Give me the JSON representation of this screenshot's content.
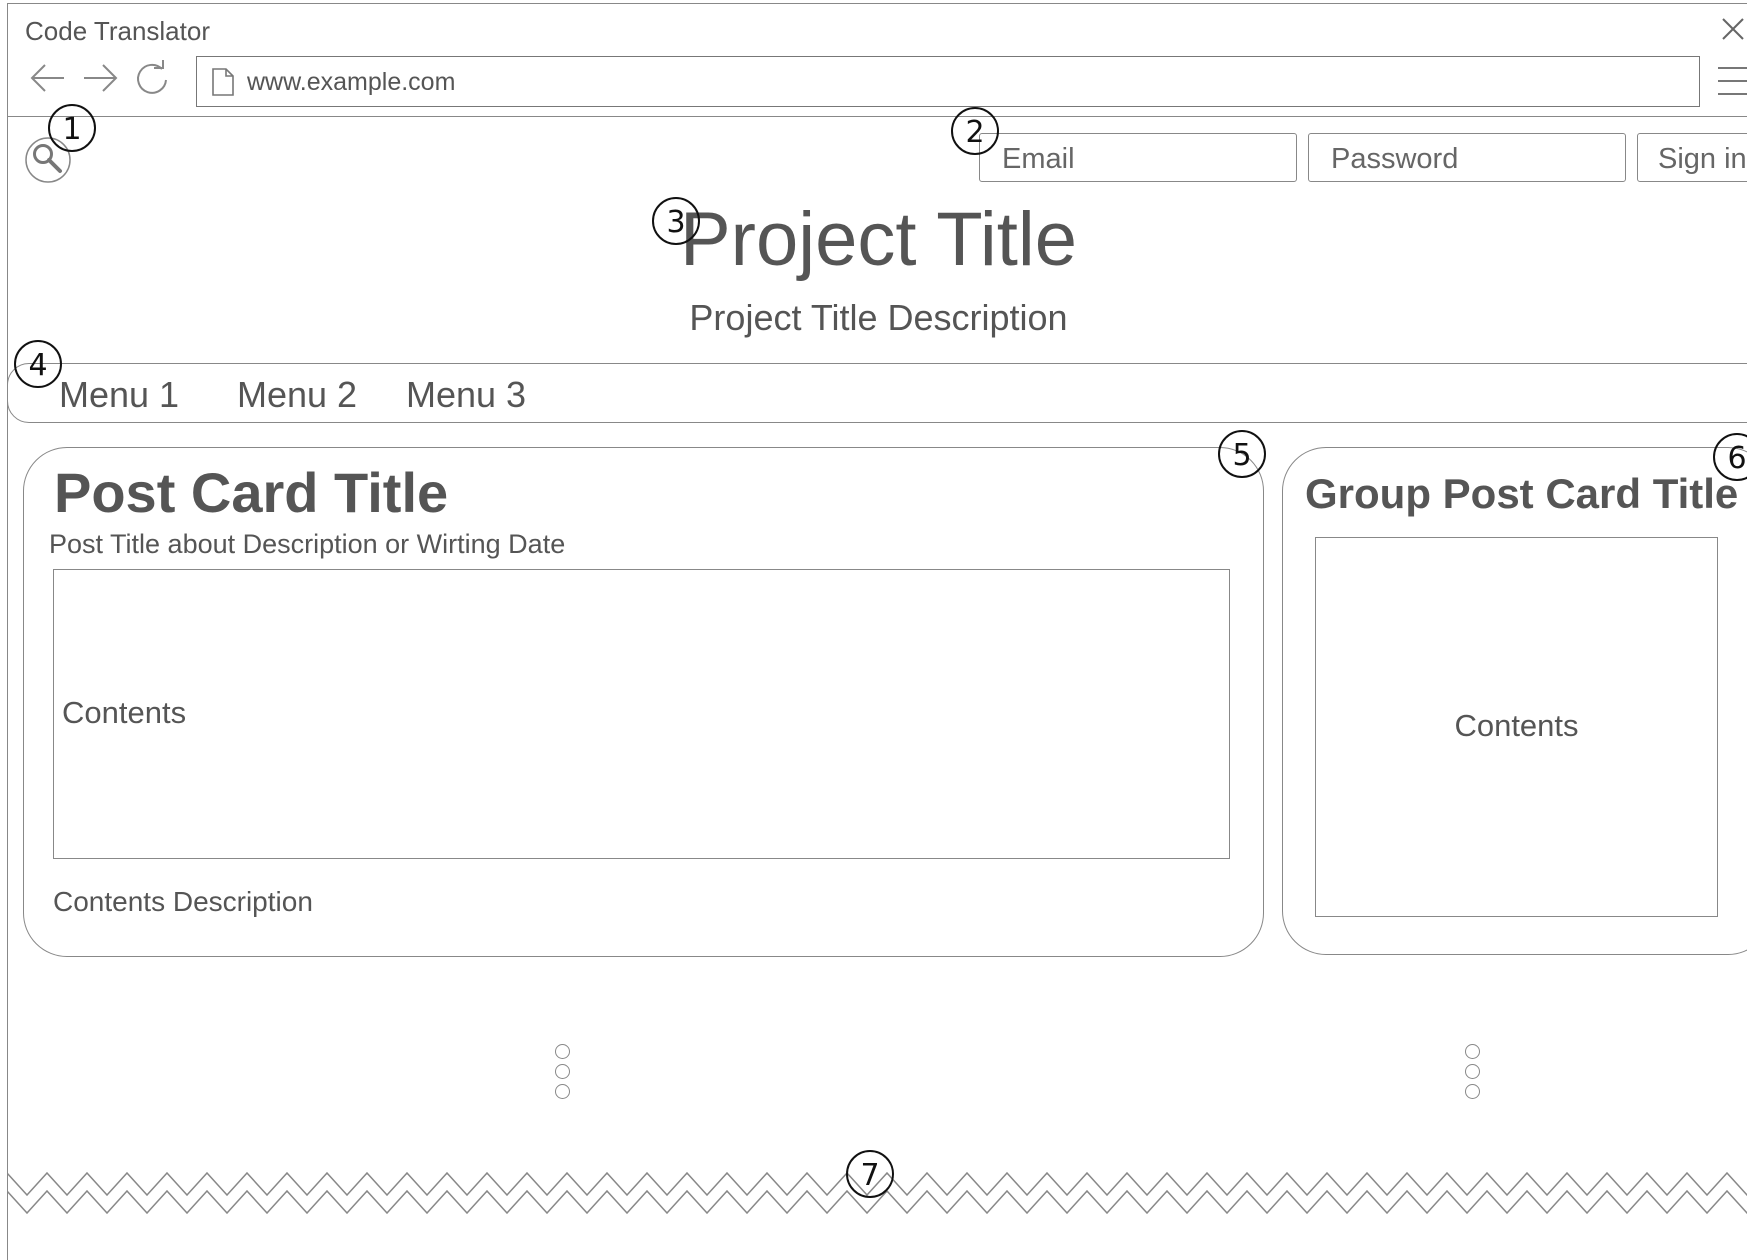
{
  "browser": {
    "title": "Code Translator",
    "url": "www.example.com"
  },
  "header": {
    "email_placeholder": "Email",
    "password_placeholder": "Password",
    "signin_label": "Sign in",
    "project_title": "Project Title",
    "project_description": "Project Title Description"
  },
  "menu": {
    "items": [
      "Menu 1",
      "Menu 2",
      "Menu 3"
    ]
  },
  "post_card": {
    "title": "Post Card Title",
    "subtitle": "Post Title about Description or Wirting Date",
    "contents": "Contents",
    "contents_description": "Contents Description"
  },
  "group_card": {
    "title": "Group Post Card Title",
    "contents": "Contents"
  },
  "annotations": [
    "1",
    "2",
    "3",
    "4",
    "5",
    "6",
    "7"
  ]
}
